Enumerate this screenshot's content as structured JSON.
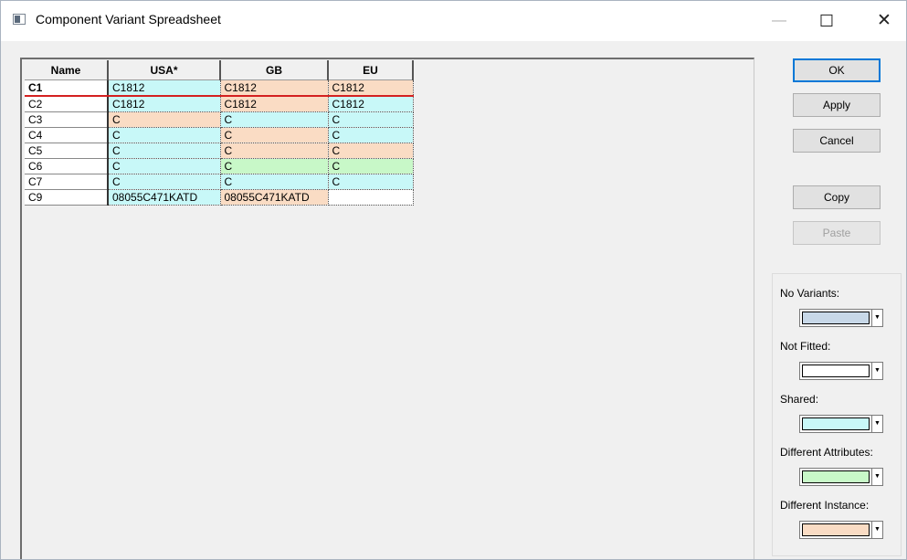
{
  "window": {
    "title": "Component Variant Spreadsheet",
    "minimize_glyph": "—",
    "maximize_glyph": "☐",
    "close_glyph": "✕"
  },
  "grid": {
    "headers": [
      "Name",
      "USA*",
      "GB",
      "EU"
    ],
    "rows": [
      {
        "name": "C1",
        "cells": [
          {
            "value": "C1812",
            "color": "#c8f8f8"
          },
          {
            "value": "C1812",
            "color": "#fadcc4"
          },
          {
            "value": "C1812",
            "color": "#fadcc4"
          }
        ]
      },
      {
        "name": "C2",
        "cells": [
          {
            "value": "C1812",
            "color": "#c8f8f8"
          },
          {
            "value": "C1812",
            "color": "#fadcc4"
          },
          {
            "value": "C1812",
            "color": "#c8f8f8"
          }
        ]
      },
      {
        "name": "C3",
        "cells": [
          {
            "value": "C",
            "color": "#fadcc4"
          },
          {
            "value": "C",
            "color": "#c8f8f8"
          },
          {
            "value": "C",
            "color": "#c8f8f8"
          }
        ]
      },
      {
        "name": "C4",
        "cells": [
          {
            "value": "C",
            "color": "#c8f8f8"
          },
          {
            "value": "C",
            "color": "#fadcc4"
          },
          {
            "value": "C",
            "color": "#c8f8f8"
          }
        ]
      },
      {
        "name": "C5",
        "cells": [
          {
            "value": "C",
            "color": "#c8f8f8"
          },
          {
            "value": "C",
            "color": "#fadcc4"
          },
          {
            "value": "C",
            "color": "#fadcc4"
          }
        ]
      },
      {
        "name": "C6",
        "cells": [
          {
            "value": "C",
            "color": "#c8f8f8"
          },
          {
            "value": "C",
            "color": "#c8f8c8"
          },
          {
            "value": "C",
            "color": "#c8f8c8"
          }
        ]
      },
      {
        "name": "C7",
        "cells": [
          {
            "value": "C",
            "color": "#c8f8f8"
          },
          {
            "value": "C",
            "color": "#c8f8f8"
          },
          {
            "value": "C",
            "color": "#c8f8f8"
          }
        ]
      },
      {
        "name": "C9",
        "cells": [
          {
            "value": "08055C471KATD",
            "color": "#c8f8f8"
          },
          {
            "value": "08055C471KATD",
            "color": "#fadcc4"
          },
          {
            "value": "",
            "color": "#ffffff"
          }
        ]
      }
    ]
  },
  "buttons": {
    "ok": "OK",
    "apply": "Apply",
    "cancel": "Cancel",
    "copy": "Copy",
    "paste": "Paste"
  },
  "legend": [
    {
      "label": "No Variants:",
      "color": "#c8d8e8"
    },
    {
      "label": "Not Fitted:",
      "color": "#ffffff"
    },
    {
      "label": "Shared:",
      "color": "#c8f8f8"
    },
    {
      "label": "Different Attributes:",
      "color": "#c8f8c8"
    },
    {
      "label": "Different Instance:",
      "color": "#fadcc4"
    }
  ]
}
